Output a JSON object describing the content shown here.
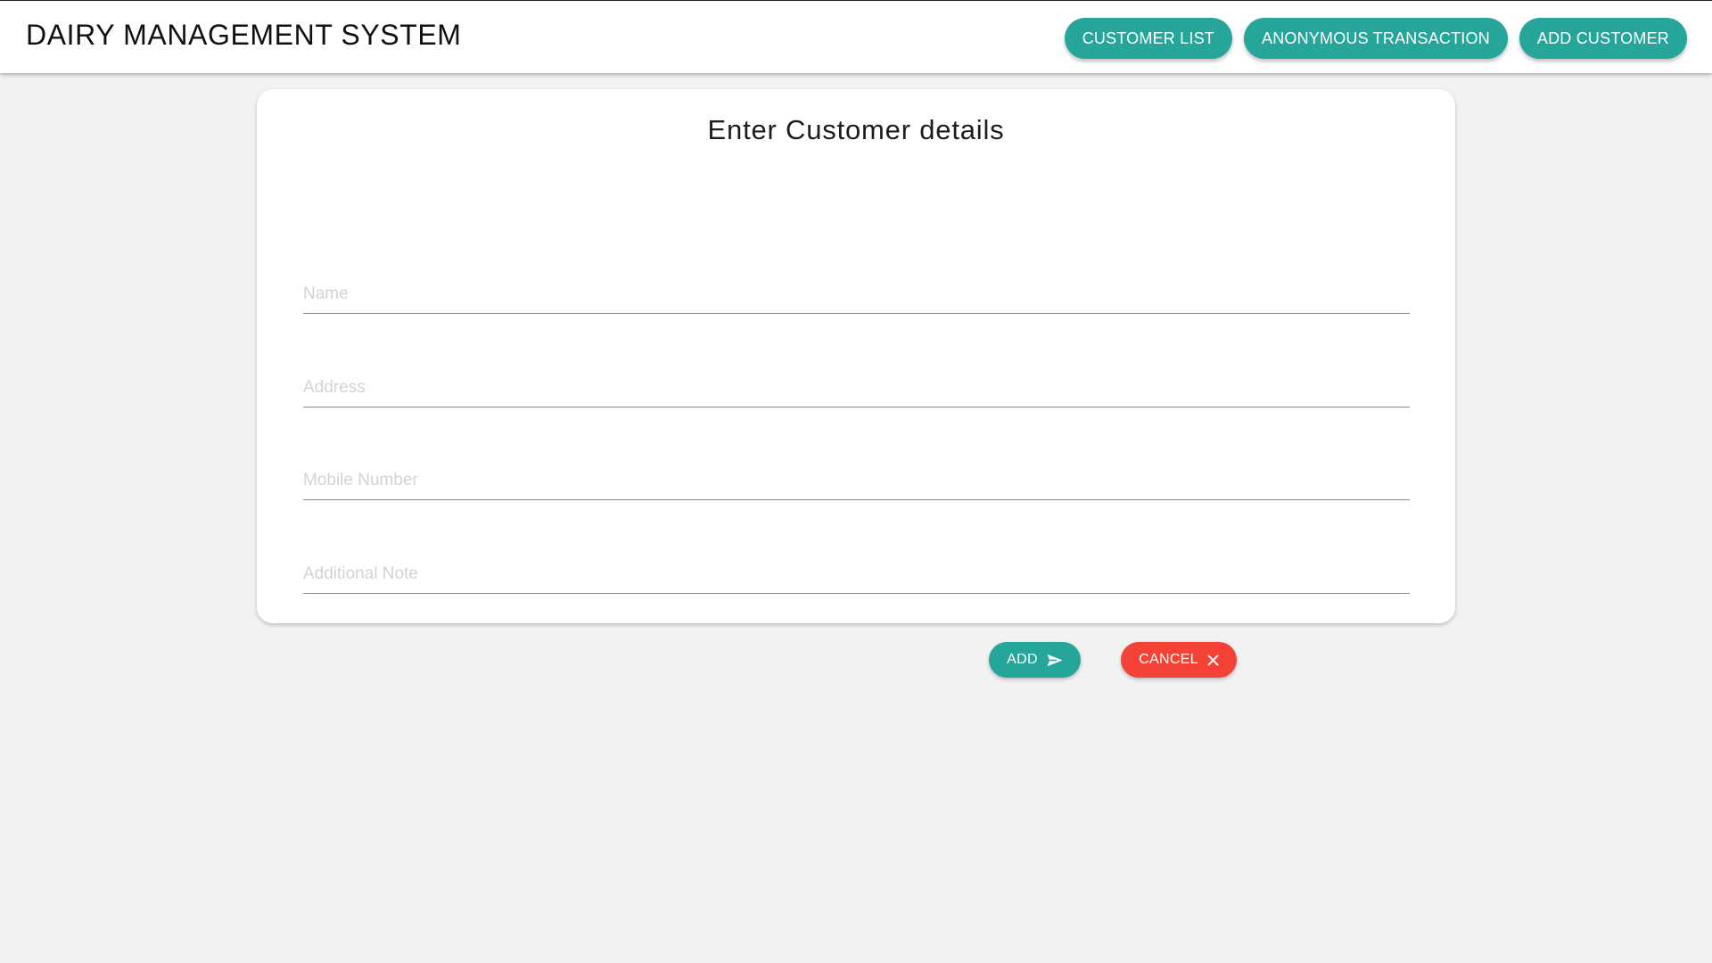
{
  "header": {
    "title": "DAIRY MANAGEMENT SYSTEM",
    "nav": {
      "customer_list": "CUSTOMER LIST",
      "anonymous_transaction": "ANONYMOUS TRANSACTION",
      "add_customer": "ADD CUSTOMER"
    }
  },
  "form": {
    "title": "Enter Customer details",
    "fields": {
      "name": {
        "placeholder": "Name",
        "value": ""
      },
      "address": {
        "placeholder": "Address",
        "value": ""
      },
      "mobile": {
        "placeholder": "Mobile Number",
        "value": ""
      },
      "note": {
        "placeholder": "Additional Note",
        "value": ""
      }
    },
    "actions": {
      "add_label": "ADD",
      "add_icon": "send-icon",
      "cancel_label": "CANCEL",
      "cancel_icon": "close-icon"
    }
  },
  "colors": {
    "accent": "#26a69a",
    "danger": "#f44336",
    "background": "#f2f2f2",
    "surface": "#ffffff"
  }
}
